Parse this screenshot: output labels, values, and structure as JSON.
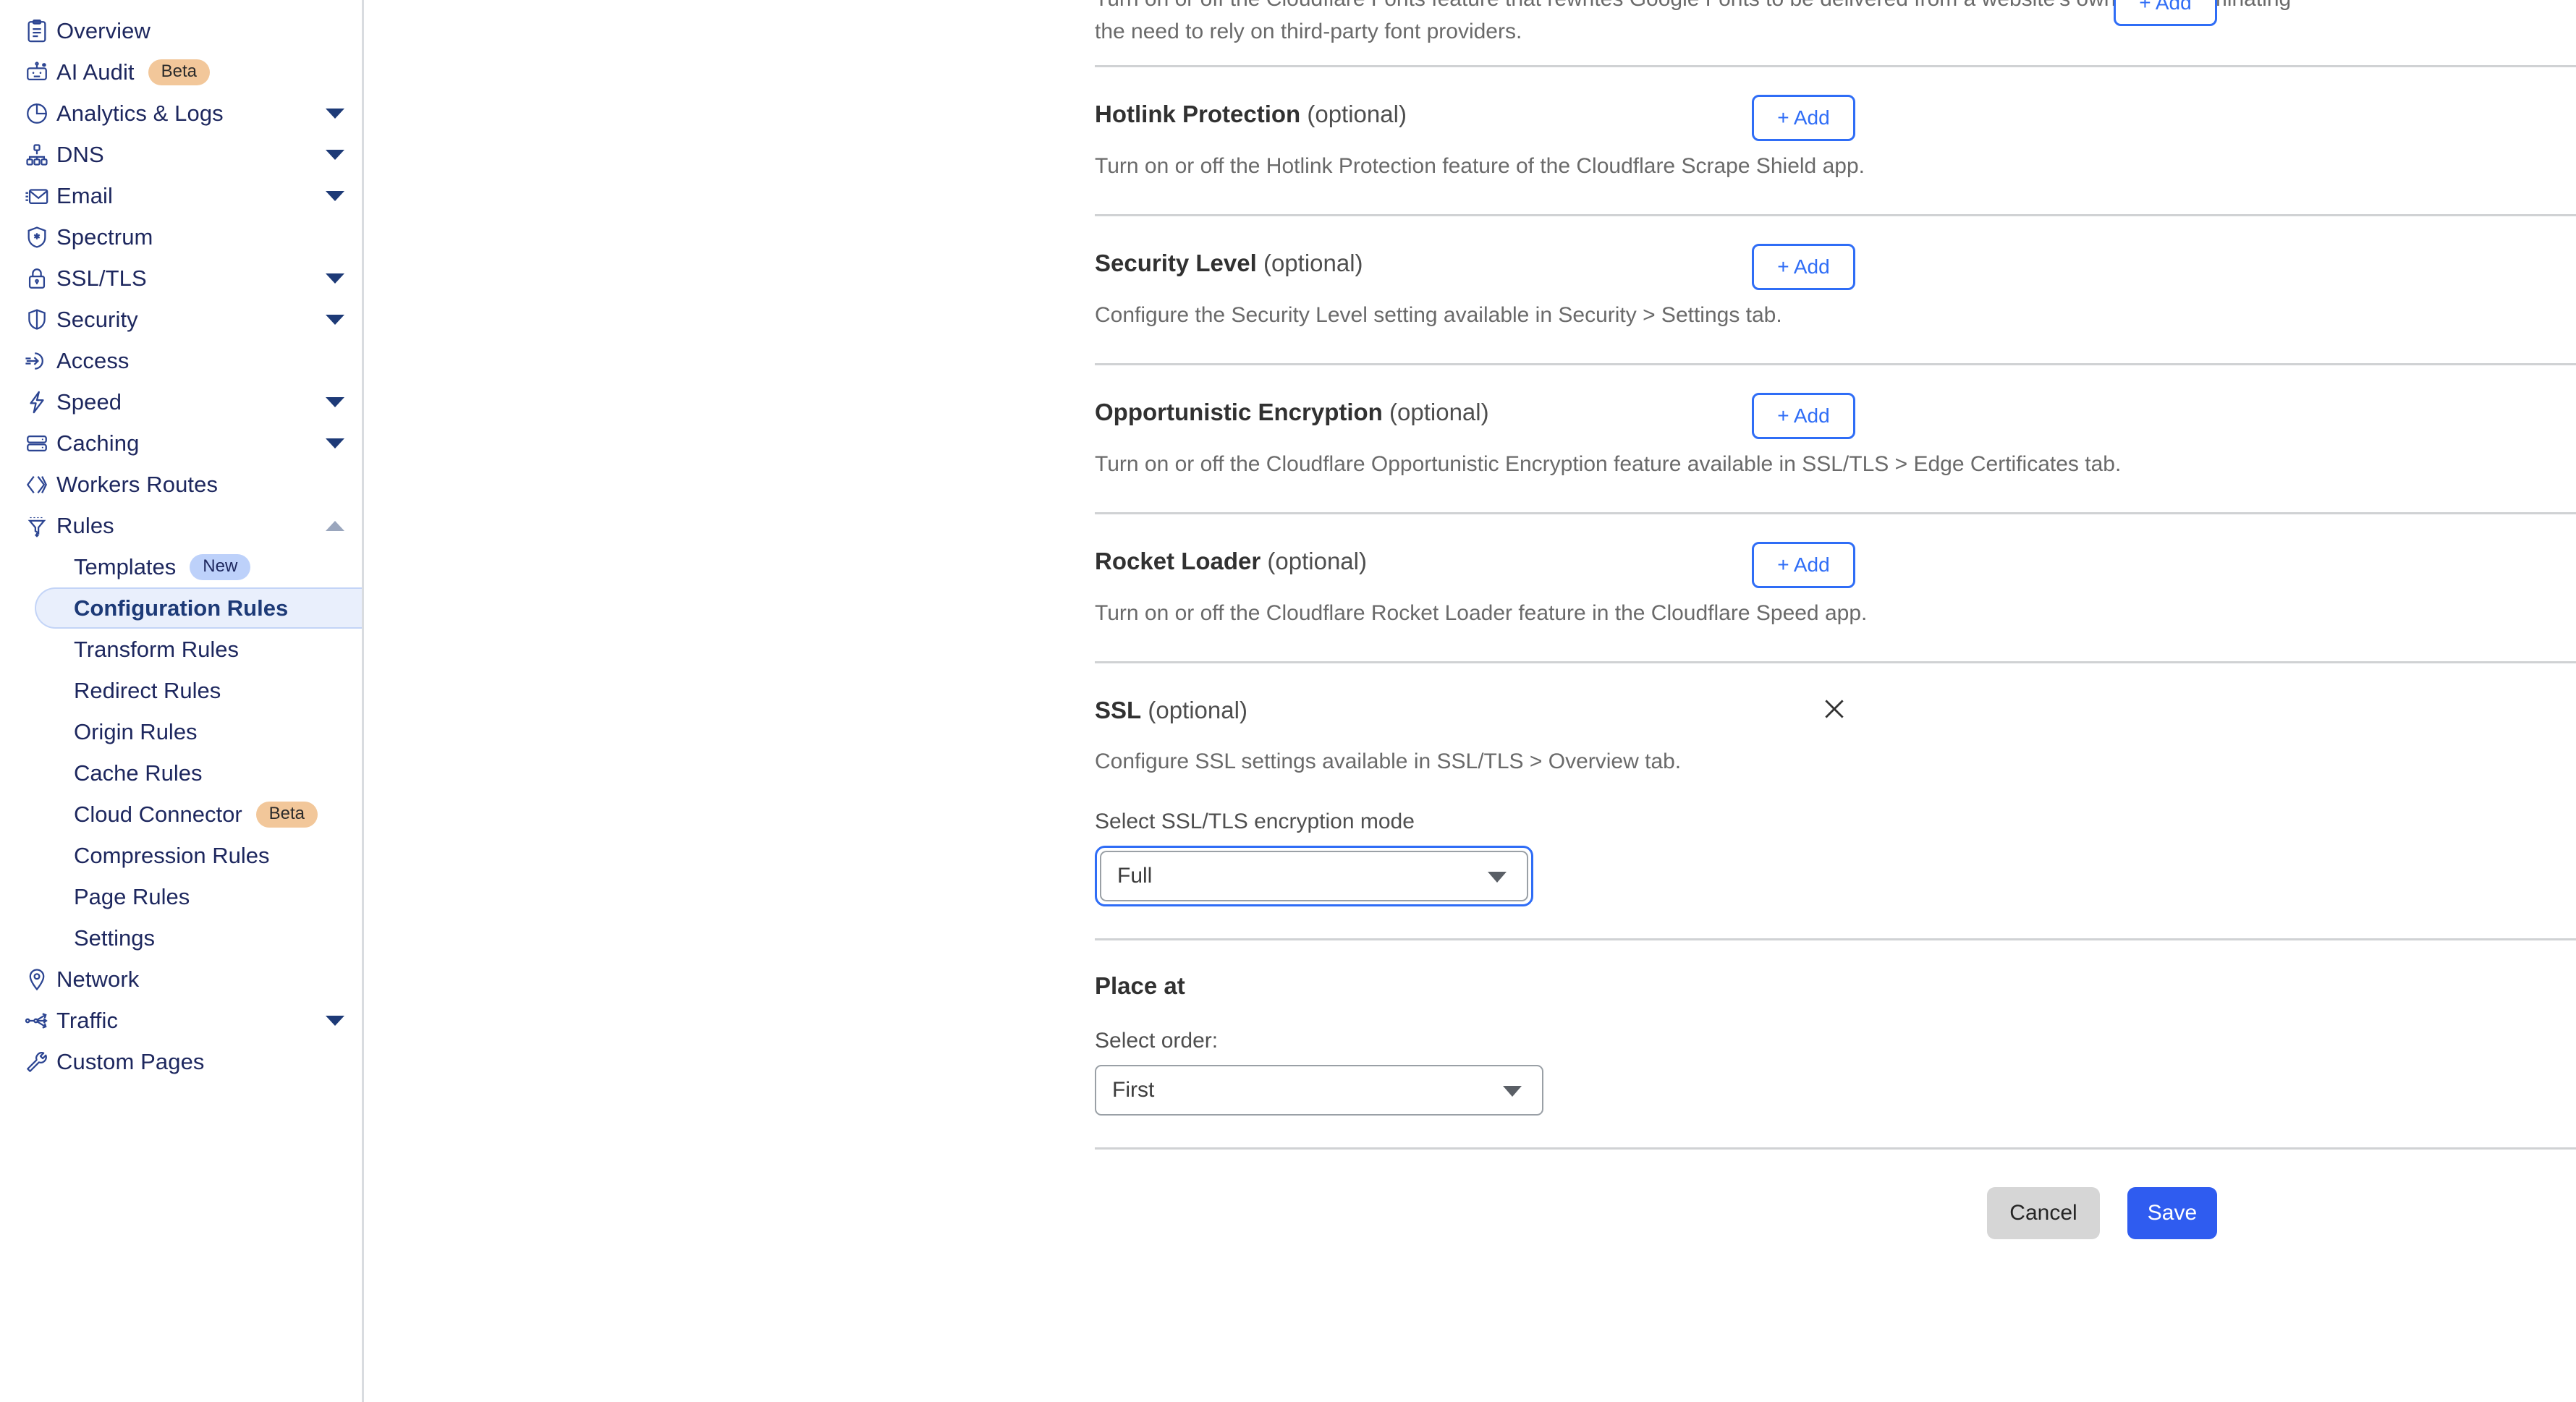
{
  "sidebar": {
    "items": [
      {
        "label": "Overview",
        "icon": "clipboard-icon",
        "expandable": false
      },
      {
        "label": "AI Audit",
        "icon": "robot-icon",
        "expandable": false,
        "badge": "Beta",
        "badge_kind": "beta"
      },
      {
        "label": "Analytics & Logs",
        "icon": "pie-chart-icon",
        "expandable": true
      },
      {
        "label": "DNS",
        "icon": "sitemap-icon",
        "expandable": true
      },
      {
        "label": "Email",
        "icon": "envelope-icon",
        "expandable": true
      },
      {
        "label": "Spectrum",
        "icon": "shield-asterisk-icon",
        "expandable": false
      },
      {
        "label": "SSL/TLS",
        "icon": "lock-icon",
        "expandable": true
      },
      {
        "label": "Security",
        "icon": "shield-icon",
        "expandable": true
      },
      {
        "label": "Access",
        "icon": "login-arrow-icon",
        "expandable": false
      },
      {
        "label": "Speed",
        "icon": "bolt-icon",
        "expandable": true
      },
      {
        "label": "Caching",
        "icon": "server-icon",
        "expandable": true
      },
      {
        "label": "Workers Routes",
        "icon": "code-brackets-icon",
        "expandable": false
      },
      {
        "label": "Rules",
        "icon": "funnel-icon",
        "expandable": true,
        "expanded": true
      }
    ],
    "rules_subitems": [
      {
        "label": "Templates",
        "badge": "New",
        "badge_kind": "new",
        "active": false
      },
      {
        "label": "Configuration Rules",
        "active": true
      },
      {
        "label": "Transform Rules",
        "active": false
      },
      {
        "label": "Redirect Rules",
        "active": false
      },
      {
        "label": "Origin Rules",
        "active": false
      },
      {
        "label": "Cache Rules",
        "active": false
      },
      {
        "label": "Cloud Connector",
        "badge": "Beta",
        "badge_kind": "beta",
        "active": false
      },
      {
        "label": "Compression Rules",
        "active": false
      },
      {
        "label": "Page Rules",
        "active": false
      },
      {
        "label": "Settings",
        "active": false
      }
    ],
    "items_after_rules": [
      {
        "label": "Network",
        "icon": "map-pin-icon",
        "expandable": false
      },
      {
        "label": "Traffic",
        "icon": "traffic-split-icon",
        "expandable": true
      },
      {
        "label": "Custom Pages",
        "icon": "wrench-icon",
        "expandable": false
      }
    ]
  },
  "main": {
    "fonts_desc_clipped": "Turn on or off the Cloudflare Fonts feature that rewrites Google Fonts to be delivered from a website's own origin, eliminating the need to rely on third-party font providers.",
    "add_label": "+ Add",
    "features": [
      {
        "name": "Hotlink Protection",
        "optional": "(optional)",
        "description": "Turn on or off the Hotlink Protection feature of the Cloudflare Scrape Shield app.",
        "action": "+ Add"
      },
      {
        "name": "Security Level",
        "optional": "(optional)",
        "description": "Configure the Security Level setting available in Security > Settings tab.",
        "action": "+ Add"
      },
      {
        "name": "Opportunistic Encryption",
        "optional": "(optional)",
        "description": "Turn on or off the Cloudflare Opportunistic Encryption feature available in SSL/TLS > Edge Certificates tab.",
        "action": "+ Add"
      },
      {
        "name": "Rocket Loader",
        "optional": "(optional)",
        "description": "Turn on or off the Cloudflare Rocket Loader feature in the Cloudflare Speed app.",
        "action": "+ Add"
      }
    ],
    "ssl_section": {
      "name": "SSL",
      "optional": "(optional)",
      "description": "Configure SSL settings available in SSL/TLS > Overview tab.",
      "field_label": "Select SSL/TLS encryption mode",
      "selected_value": "Full",
      "focused": true
    },
    "place_at": {
      "title": "Place at",
      "field_label": "Select order:",
      "selected_value": "First"
    },
    "footer": {
      "cancel_label": "Cancel",
      "save_label": "Save"
    }
  },
  "colors": {
    "accent_blue": "#2f6df6",
    "save_blue": "#2f5cf0",
    "sidebar_icon": "#2c4592",
    "sidebar_text": "#1d275e",
    "active_bg": "#e9effc",
    "beta_badge": "#f2c79a",
    "new_badge": "#bdd1fa",
    "divider": "#d0d2d4"
  }
}
